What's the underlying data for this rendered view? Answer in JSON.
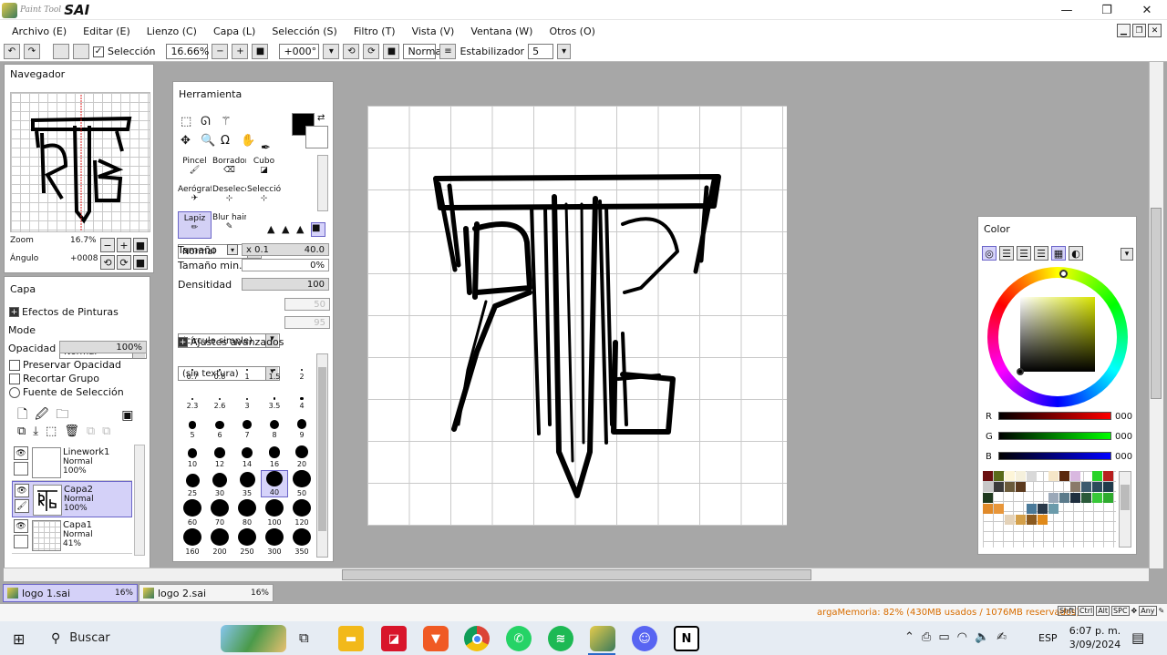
{
  "app": {
    "brand_small": "Paint Tool",
    "brand_name": "SAI"
  },
  "menu": [
    "Archivo (E)",
    "Editar (E)",
    "Lienzo (C)",
    "Capa (L)",
    "Selección (S)",
    "Filtro (T)",
    "Vista (V)",
    "Ventana (W)",
    "Otros (O)"
  ],
  "toolbar": {
    "selection_label": "Selección",
    "zoom": "16.66%",
    "angle": "+000°",
    "blend": "Normal",
    "stabilizer_label": "Estabilizador",
    "stabilizer": "5"
  },
  "navigator": {
    "title": "Navegador",
    "zoom_label": "Zoom",
    "zoom_value": "16.7%",
    "angle_label": "Ángulo",
    "angle_value": "+0008"
  },
  "layer_panel": {
    "title": "Capa",
    "effects": "Efectos de Pinturas",
    "mode_label": "Mode",
    "mode_value": "Normal",
    "opacity_label": "Opacidad",
    "opacity_value": "100%",
    "options": [
      "Preservar Opacidad",
      "Recortar Grupo",
      "Fuente de Selección"
    ],
    "layers": [
      {
        "name": "Linework1",
        "mode": "Normal",
        "opacity": "100%"
      },
      {
        "name": "Capa2",
        "mode": "Normal",
        "opacity": "100%"
      },
      {
        "name": "Capa1",
        "mode": "Normal",
        "opacity": "41%"
      }
    ]
  },
  "tool_panel": {
    "title": "Herramienta",
    "tools": [
      "Pincel",
      "Borrador",
      "Cubo",
      "Aerógraf",
      "Deselecc",
      "Selecció",
      "Lapiz",
      "Blur hair"
    ],
    "blend": "Normal",
    "size_label": "Tamaño",
    "size_mult": "x 0.1",
    "size_value": "40.0",
    "min_size_label": "Tamaño min.",
    "min_size_value": "0%",
    "density_label": "Densitidad",
    "density_value": "100",
    "shape": "(círculo simple)",
    "shape_value": "50",
    "texture": "(sin textura)",
    "texture_value": "95",
    "advanced": "Ajustes avanzados",
    "brush_sizes": [
      "0.7",
      "0.8",
      "1",
      "1.5",
      "2",
      "2.3",
      "2.6",
      "3",
      "3.5",
      "4",
      "5",
      "6",
      "7",
      "8",
      "9",
      "10",
      "12",
      "14",
      "16",
      "20",
      "25",
      "30",
      "35",
      "40",
      "50",
      "60",
      "70",
      "80",
      "100",
      "120",
      "160",
      "200",
      "250",
      "300",
      "350"
    ]
  },
  "color_panel": {
    "title": "Color",
    "r_label": "R",
    "r_value": "000",
    "g_label": "G",
    "g_value": "000",
    "b_label": "B",
    "b_value": "000",
    "swatches": [
      "#6b1111",
      "#5a6b1a",
      "#fdf5d8",
      "#f5f0dc",
      "#d9d9d9",
      "#ffffff",
      "#f5e6c8",
      "#5b2a0e",
      "#d9b8e0",
      "#ffffff",
      "#29d329",
      "#b81f1f",
      "#c7c7c7",
      "#3b3b3b",
      "#6b5b3b",
      "#5c3a1e",
      "#ffffff",
      "#ffffff",
      "#ffffff",
      "#ffffff",
      "#8a7a6a",
      "#3c5a6e",
      "#2b4b5b",
      "#1f3b4b",
      "#1f3a1f",
      "#ffffff",
      "#ffffff",
      "#ffffff",
      "#ffffff",
      "#ffffff",
      "#9aa8b8",
      "#5b7b8b",
      "#1f2f3f",
      "#2a5a3a",
      "#38c838",
      "#2eab2e",
      "#e08a2a",
      "#e8963a",
      "#ffffff",
      "#ffffff",
      "#4a7a9a",
      "#2a3a4a",
      "#6b9bab",
      "#ffffff",
      "#ffffff",
      "#ffffff",
      "#ffffff",
      "#ffffff",
      "#ffffff",
      "#ffffff",
      "#e4d2b8",
      "#d4a04a",
      "#8b5a1f",
      "#e08a1a",
      "#ffffff",
      "#ffffff",
      "#ffffff",
      "#ffffff",
      "#ffffff",
      "#ffffff"
    ]
  },
  "documents": [
    {
      "name": "logo 1.sai",
      "zoom": "16%"
    },
    {
      "name": "logo 2.sai",
      "zoom": "16%"
    }
  ],
  "status": {
    "memory": "argaMemoria: 82% (430MB usados / 1076MB reservados)",
    "keys": [
      "Shft",
      "Ctrl",
      "Alt",
      "SPC",
      "Any"
    ]
  },
  "taskbar": {
    "search": "Buscar",
    "lang": "ESP",
    "time": "6:07 p. m.",
    "date": "3/09/2024"
  },
  "colors": {
    "accent": "#6a64c8",
    "active_bg": "#d4d1f8",
    "memory_text": "#d86d00"
  }
}
